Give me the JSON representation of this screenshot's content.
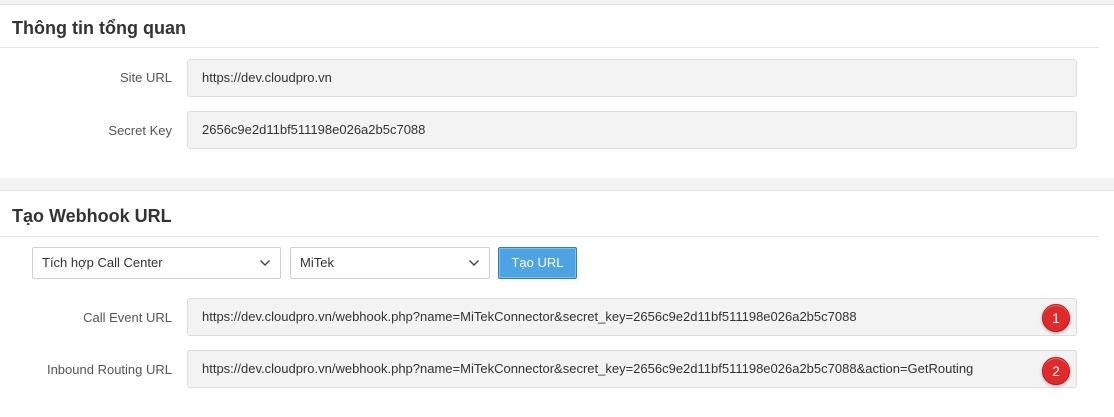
{
  "overview": {
    "title": "Thông tin tổng quan",
    "site_url_label": "Site URL",
    "site_url_value": "https://dev.cloudpro.vn",
    "secret_key_label": "Secret Key",
    "secret_key_value": "2656c9e2d11bf511198e026a2b5c7088"
  },
  "webhook": {
    "title": "Tạo Webhook URL",
    "integration_select": "Tích hợp Call Center",
    "provider_select": "MiTek",
    "create_button": "Tạo URL",
    "call_event_label": "Call Event URL",
    "call_event_value": "https://dev.cloudpro.vn/webhook.php?name=MiTekConnector&secret_key=2656c9e2d11bf511198e026a2b5c7088",
    "inbound_label": "Inbound Routing URL",
    "inbound_value": "https://dev.cloudpro.vn/webhook.php?name=MiTekConnector&secret_key=2656c9e2d11bf511198e026a2b5c7088&action=GetRouting",
    "badge_1": "1",
    "badge_2": "2"
  },
  "colors": {
    "accent": "#4ea3e2",
    "badge": "#e02a2a"
  },
  "icons": {
    "dropdown": "chevron-down-icon"
  }
}
